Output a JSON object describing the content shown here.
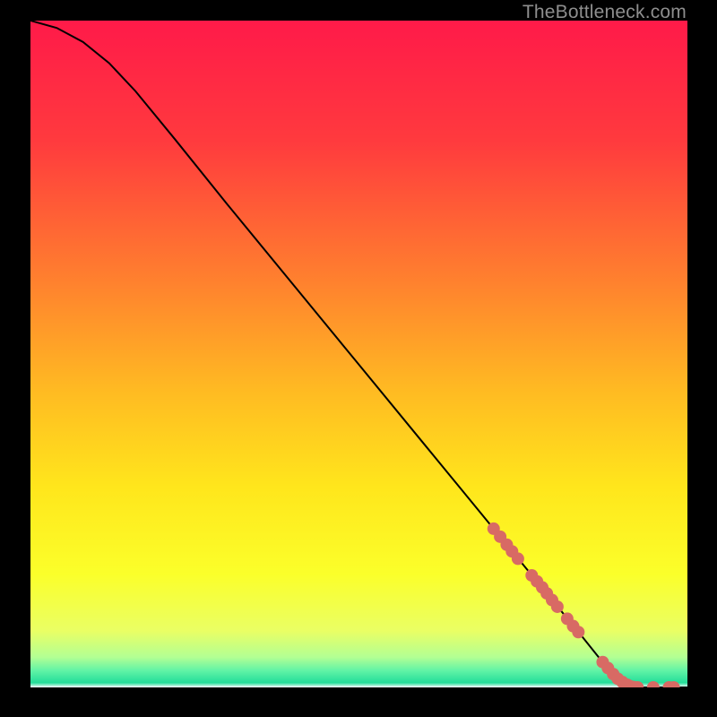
{
  "watermark": "TheBottleneck.com",
  "chart_data": {
    "type": "line",
    "title": "",
    "xlabel": "",
    "ylabel": "",
    "xlim": [
      0,
      100
    ],
    "ylim": [
      0,
      100
    ],
    "grid": false,
    "background_gradient": {
      "stops": [
        {
          "offset": 0.0,
          "color": "#ff1a49"
        },
        {
          "offset": 0.18,
          "color": "#ff3a3e"
        },
        {
          "offset": 0.38,
          "color": "#ff7d2f"
        },
        {
          "offset": 0.56,
          "color": "#ffbc22"
        },
        {
          "offset": 0.7,
          "color": "#ffe61c"
        },
        {
          "offset": 0.83,
          "color": "#fbff2a"
        },
        {
          "offset": 0.915,
          "color": "#eaff64"
        },
        {
          "offset": 0.955,
          "color": "#b2ff94"
        },
        {
          "offset": 0.975,
          "color": "#60f3a6"
        },
        {
          "offset": 0.993,
          "color": "#24dd9a"
        },
        {
          "offset": 1.0,
          "color": "#ffffff"
        }
      ]
    },
    "series": [
      {
        "name": "curve",
        "type": "line",
        "color": "#000000",
        "points": [
          {
            "x": 0.0,
            "y": 100.0
          },
          {
            "x": 4.0,
            "y": 98.9
          },
          {
            "x": 8.0,
            "y": 96.8
          },
          {
            "x": 12.0,
            "y": 93.6
          },
          {
            "x": 16.0,
            "y": 89.4
          },
          {
            "x": 22.0,
            "y": 82.2
          },
          {
            "x": 30.0,
            "y": 72.4
          },
          {
            "x": 40.0,
            "y": 60.4
          },
          {
            "x": 50.0,
            "y": 48.4
          },
          {
            "x": 60.0,
            "y": 36.4
          },
          {
            "x": 70.0,
            "y": 24.4
          },
          {
            "x": 78.0,
            "y": 14.8
          },
          {
            "x": 84.0,
            "y": 7.6
          },
          {
            "x": 87.0,
            "y": 3.9
          },
          {
            "x": 89.0,
            "y": 1.8
          },
          {
            "x": 90.5,
            "y": 0.6
          },
          {
            "x": 92.0,
            "y": 0.0
          },
          {
            "x": 100.0,
            "y": 0.0
          }
        ]
      },
      {
        "name": "markers",
        "type": "scatter",
        "color": "#d86a64",
        "radius": 7,
        "points": [
          {
            "x": 70.5,
            "y": 23.8
          },
          {
            "x": 71.5,
            "y": 22.6
          },
          {
            "x": 72.5,
            "y": 21.4
          },
          {
            "x": 73.3,
            "y": 20.4
          },
          {
            "x": 74.2,
            "y": 19.3
          },
          {
            "x": 76.3,
            "y": 16.8
          },
          {
            "x": 77.1,
            "y": 15.9
          },
          {
            "x": 77.9,
            "y": 15.0
          },
          {
            "x": 78.6,
            "y": 14.1
          },
          {
            "x": 79.4,
            "y": 13.1
          },
          {
            "x": 80.2,
            "y": 12.1
          },
          {
            "x": 81.7,
            "y": 10.3
          },
          {
            "x": 82.6,
            "y": 9.2
          },
          {
            "x": 83.4,
            "y": 8.3
          },
          {
            "x": 87.1,
            "y": 3.8
          },
          {
            "x": 87.9,
            "y": 2.9
          },
          {
            "x": 88.7,
            "y": 2.0
          },
          {
            "x": 89.4,
            "y": 1.3
          },
          {
            "x": 90.1,
            "y": 0.8
          },
          {
            "x": 90.8,
            "y": 0.4
          },
          {
            "x": 91.2,
            "y": 0.2
          },
          {
            "x": 91.8,
            "y": 0.05
          },
          {
            "x": 92.4,
            "y": 0.0
          },
          {
            "x": 94.8,
            "y": 0.0
          },
          {
            "x": 97.2,
            "y": 0.0
          },
          {
            "x": 97.9,
            "y": 0.0
          }
        ]
      }
    ]
  }
}
